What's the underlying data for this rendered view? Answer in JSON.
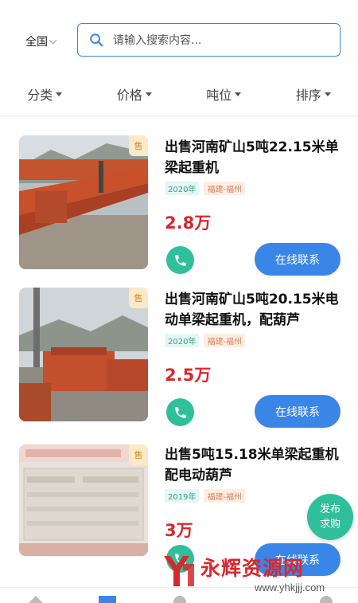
{
  "header": {
    "region": "全国",
    "search_placeholder": "请输入搜索内容..."
  },
  "filters": [
    "分类",
    "价格",
    "吨位",
    "排序"
  ],
  "listings": [
    {
      "badge": "售",
      "title": "出售河南矿山5吨22.15米单梁起重机",
      "year": "2020年",
      "location": "福建-福州",
      "price": "2.8万",
      "contact_label": "在线联系"
    },
    {
      "badge": "售",
      "title": "出售河南矿山5吨20.15米电动单梁起重机，配葫芦",
      "year": "2020年",
      "location": "福建-福州",
      "price": "2.5万",
      "contact_label": "在线联系"
    },
    {
      "badge": "售",
      "title": "出售5吨15.18米单梁起重机配电动葫芦",
      "year": "2019年",
      "location": "福建-福州",
      "price": "3万",
      "contact_label": "在线联系"
    }
  ],
  "fab": {
    "line1": "发布",
    "line2": "求购"
  },
  "watermark": {
    "text": "永辉资源网",
    "url": "www.yhkjjj.com"
  },
  "colors": {
    "accent": "#3a86e8",
    "green": "#2fbf9b",
    "price": "#d8282d"
  }
}
